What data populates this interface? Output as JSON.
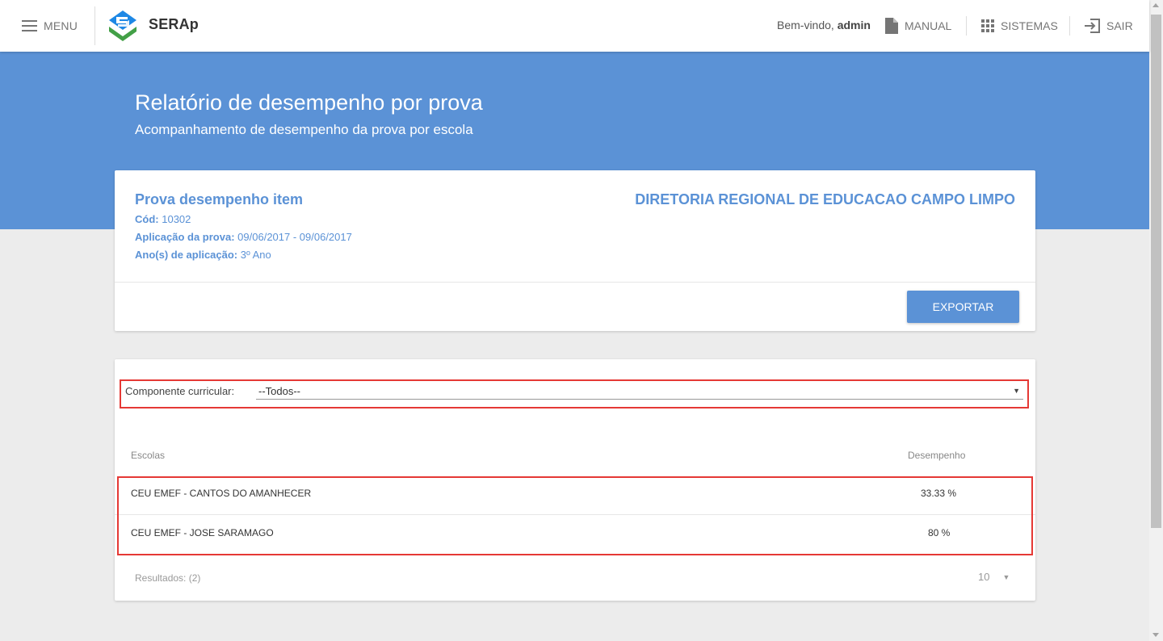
{
  "header": {
    "menu_label": "MENU",
    "brand": "SERAp",
    "welcome_prefix": "Bem-vindo, ",
    "welcome_user": "admin",
    "manual_label": "MANUAL",
    "sistemas_label": "SISTEMAS",
    "sair_label": "SAIR"
  },
  "banner": {
    "title": "Relatório de desempenho por prova",
    "subtitle": "Acompanhamento de desempenho da prova por escola"
  },
  "prova": {
    "name": "Prova desempenho item",
    "cod_label": "Cód:",
    "cod_value": "10302",
    "aplicacao_label": "Aplicação da prova:",
    "aplicacao_value": "09/06/2017 - 09/06/2017",
    "ano_label": "Ano(s) de aplicação:",
    "ano_value": "3º Ano",
    "dre": "DIRETORIA REGIONAL DE EDUCACAO CAMPO LIMPO",
    "export_label": "EXPORTAR"
  },
  "filter": {
    "label": "Componente curricular:",
    "selected": "--Todos--"
  },
  "table": {
    "col_escolas": "Escolas",
    "col_desempenho": "Desempenho",
    "rows": [
      {
        "school": "CEU EMEF - CANTOS DO AMANHECER",
        "perf": "33.33 %"
      },
      {
        "school": "CEU EMEF - JOSE SARAMAGO",
        "perf": "80 %"
      }
    ],
    "results": "Resultados: (2)",
    "page_size": "10"
  },
  "colors": {
    "primary": "#5b92d6",
    "highlight": "#e53935",
    "logo_blue": "#1e88e5",
    "logo_green": "#43a047"
  }
}
